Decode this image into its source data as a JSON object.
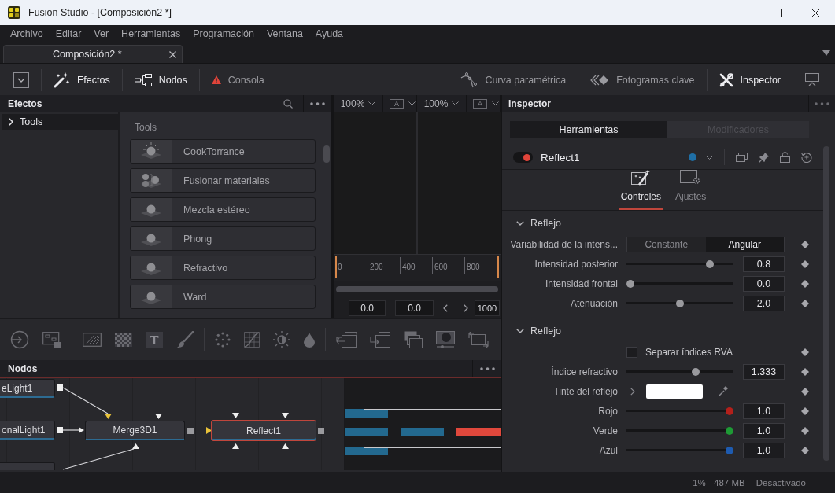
{
  "window": {
    "title": "Fusion Studio - [Composición2 *]"
  },
  "menu": [
    "Archivo",
    "Editar",
    "Ver",
    "Herramientas",
    "Programación",
    "Ventana",
    "Ayuda"
  ],
  "document_tabs": [
    {
      "label": "Composición2 *",
      "selected": true
    }
  ],
  "toolbar": {
    "left": [
      {
        "label": "Efectos",
        "selected": true
      },
      {
        "label": "Nodos",
        "selected": true
      },
      {
        "label": "Consola",
        "selected": false
      }
    ],
    "right": [
      {
        "label": "Curva paramétrica",
        "selected": false
      },
      {
        "label": "Fotogramas clave",
        "selected": false
      },
      {
        "label": "Inspector",
        "selected": true
      }
    ]
  },
  "effects_panel": {
    "title": "Efectos",
    "tree": [
      {
        "label": "Tools",
        "expanded": false,
        "selected": true
      }
    ],
    "list_title": "Tools",
    "items": [
      "CookTorrance",
      "Fusionar materiales",
      "Mezcla estéreo",
      "Phong",
      "Refractivo",
      "Ward"
    ]
  },
  "viewers": [
    {
      "zoom": "100%",
      "channel": "A"
    },
    {
      "zoom": "100%",
      "channel": "A"
    }
  ],
  "timeline": {
    "ticks": [
      "0",
      "200",
      "400",
      "600",
      "800"
    ],
    "start": "0.0",
    "current": "0.0",
    "end": "1000"
  },
  "tool_bar": {
    "text_glyph": "T"
  },
  "nodes_panel": {
    "title": "Nodos",
    "nodes": [
      {
        "label": "eLight1",
        "selected": false
      },
      {
        "label": "onalLight1",
        "selected": false
      },
      {
        "label": "Merge3D1",
        "selected": false
      },
      {
        "label": "Reflect1",
        "selected": true
      }
    ]
  },
  "inspector": {
    "title": "Inspector",
    "tabs": [
      {
        "label": "Herramientas",
        "selected": true,
        "disabled": false
      },
      {
        "label": "Modificadores",
        "selected": false,
        "disabled": true
      }
    ],
    "tool": {
      "name": "Reflect1",
      "active": true
    },
    "subtabs": [
      {
        "label": "Controles",
        "selected": true
      },
      {
        "label": "Ajustes",
        "selected": false
      }
    ],
    "sections": [
      {
        "title": "Reflejo",
        "expanded": true,
        "rows": [
          {
            "kind": "choice",
            "label": "Variabilidad de la intens...",
            "options": [
              {
                "label": "Constante",
                "selected": false
              },
              {
                "label": "Angular",
                "selected": true
              }
            ]
          },
          {
            "kind": "slider",
            "label": "Intensidad posterior",
            "level": 0.8,
            "value": "0.8"
          },
          {
            "kind": "slider",
            "label": "Intensidad frontal",
            "level": 0,
            "value": "0.0"
          },
          {
            "kind": "slider",
            "label": "Atenuación",
            "level": 0.5,
            "value": "2.0"
          }
        ]
      },
      {
        "title": "Reflejo",
        "expanded": true,
        "rows": [
          {
            "kind": "checkbox",
            "label": "Separar índices RVA",
            "checked": false
          },
          {
            "kind": "slider",
            "label": "Índice refractivo",
            "level": 0.66,
            "value": "1.333"
          },
          {
            "kind": "color",
            "label": "Tinte del reflejo",
            "color": "#ffffff",
            "expanded": false
          },
          {
            "kind": "slider",
            "label": "Rojo",
            "level": 1,
            "value": "1.0",
            "color": "#b3201b"
          },
          {
            "kind": "slider",
            "label": "Verde",
            "level": 1,
            "value": "1.0",
            "color": "#1e9a35"
          },
          {
            "kind": "slider",
            "label": "Azul",
            "level": 1,
            "value": "1.0",
            "color": "#1e5bb0"
          }
        ]
      }
    ]
  },
  "status_bar": {
    "memory": "1% - 487 MB",
    "state": "Desactivado"
  }
}
